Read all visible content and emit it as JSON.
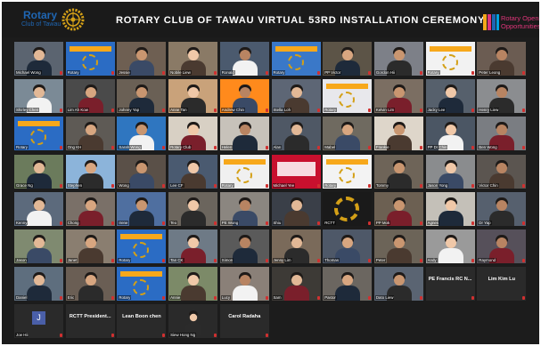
{
  "banner": {
    "title": "ROTARY CLUB OF TAWAU VIRTUAL 53RD INSTALLATION CEREMONY",
    "logo_word": "Rotary",
    "logo_club": "Club of Tawau",
    "right_line1": "Rotary Opens",
    "right_line2": "Opportunities",
    "accent_color": "#1f66b3",
    "gold_color": "#d4a017"
  },
  "tiles": [
    {
      "name": "Michael Wong",
      "kind": "person",
      "bg": "#5b6470"
    },
    {
      "name": "Rotary",
      "kind": "slide",
      "bg": "#2b6cc4"
    },
    {
      "name": "Jessie",
      "kind": "person",
      "bg": "#6e5f52"
    },
    {
      "name": "Nobile Liew",
      "kind": "person",
      "bg": "#8a7a66"
    },
    {
      "name": "Ronald",
      "kind": "person",
      "bg": "#4b5a6e"
    },
    {
      "name": "Rotary",
      "kind": "slide",
      "bg": "#3a78c8"
    },
    {
      "name": "PP Victor",
      "kind": "person",
      "bg": "#5c5447"
    },
    {
      "name": "Gordon Hii",
      "kind": "person",
      "bg": "#7d8088"
    },
    {
      "name": "Rotary",
      "kind": "slide",
      "bg": "#f2f2f2"
    },
    {
      "name": "Peter Leong",
      "kind": "person",
      "bg": "#6b5c52"
    },
    {
      "name": "Shirley Chen",
      "kind": "person",
      "bg": "#7b8a96"
    },
    {
      "name": "Lim Ah Kow",
      "kind": "person",
      "bg": "#4a4a4a"
    },
    {
      "name": "Johnny Yap",
      "kind": "person",
      "bg": "#6a6055"
    },
    {
      "name": "Anne Tan",
      "kind": "person",
      "bg": "#c9a27a"
    },
    {
      "name": "Andrew Chin",
      "kind": "person",
      "bg": "#ff8a1c"
    },
    {
      "name": "Stella Loh",
      "kind": "person",
      "bg": "#5d6675"
    },
    {
      "name": "Rotary",
      "kind": "slide",
      "bg": "#e8e8ec"
    },
    {
      "name": "Kelvin Lim",
      "kind": "person",
      "bg": "#7b6e62"
    },
    {
      "name": "Jacky Lee",
      "kind": "person",
      "bg": "#56606c"
    },
    {
      "name": "Henry Liew",
      "kind": "person",
      "bg": "#8b8d90"
    },
    {
      "name": "Rotary",
      "kind": "slide",
      "bg": "#2b6cc4"
    },
    {
      "name": "Ong KH",
      "kind": "person",
      "bg": "#5e5a55"
    },
    {
      "name": "Sarah Wong",
      "kind": "person",
      "bg": "#2f76c0"
    },
    {
      "name": "Rotary Club",
      "kind": "person",
      "bg": "#d8d0c4"
    },
    {
      "name": "Helen",
      "kind": "person",
      "bg": "#c7c2ba"
    },
    {
      "name": "Alan",
      "kind": "person",
      "bg": "#4f5865"
    },
    {
      "name": "Mabel",
      "kind": "person",
      "bg": "#6f6a60"
    },
    {
      "name": "Frankie",
      "kind": "person",
      "bg": "#ded6ca"
    },
    {
      "name": "PP Dr Chin",
      "kind": "person",
      "bg": "#4b5664"
    },
    {
      "name": "Ben Wong",
      "kind": "person",
      "bg": "#7a7d82"
    },
    {
      "name": "Grace Ng",
      "kind": "person",
      "bg": "#6b7b5c"
    },
    {
      "name": "Stephen",
      "kind": "person",
      "bg": "#8cb4da"
    },
    {
      "name": "Wong",
      "kind": "person",
      "bg": "#5a5048"
    },
    {
      "name": "Lee CF",
      "kind": "person",
      "bg": "#4a5a70"
    },
    {
      "name": "Rotary",
      "kind": "slide",
      "bg": "#f0f0f0"
    },
    {
      "name": "Michael Yee",
      "kind": "slide-red",
      "bg": "#c8102e"
    },
    {
      "name": "Rotary",
      "kind": "slide",
      "bg": "#f3f3f3"
    },
    {
      "name": "Tommy",
      "kind": "person",
      "bg": "#6e6458"
    },
    {
      "name": "Jason Yong",
      "kind": "person",
      "bg": "#8a8c8e"
    },
    {
      "name": "Victor Chin",
      "kind": "person",
      "bg": "#5b5550"
    },
    {
      "name": "Kenny",
      "kind": "person",
      "bg": "#5c6a7c"
    },
    {
      "name": "Chong",
      "kind": "person",
      "bg": "#7a7068"
    },
    {
      "name": "Irene",
      "kind": "person",
      "bg": "#4f6fa0"
    },
    {
      "name": "Teo",
      "kind": "person",
      "bg": "#6b655d"
    },
    {
      "name": "PE Wong",
      "kind": "person",
      "bg": "#8b8680"
    },
    {
      "name": "Shiu",
      "kind": "person",
      "bg": "#3a3f48"
    },
    {
      "name": "RCTT",
      "kind": "wheel",
      "bg": "#1a1a1a"
    },
    {
      "name": "PP Mok",
      "kind": "person",
      "bg": "#6c6052"
    },
    {
      "name": "Agnes",
      "kind": "person",
      "bg": "#c4c0b8"
    },
    {
      "name": "Dr Yap",
      "kind": "person",
      "bg": "#56606e"
    },
    {
      "name": "Jason",
      "kind": "person",
      "bg": "#7f8a70"
    },
    {
      "name": "Janet",
      "kind": "person",
      "bg": "#8a7e70"
    },
    {
      "name": "Rotary",
      "kind": "slide",
      "bg": "#2b6cc4"
    },
    {
      "name": "Tan CK",
      "kind": "person",
      "bg": "#6e7a86"
    },
    {
      "name": "Simon",
      "kind": "person",
      "bg": "#5a5a5a"
    },
    {
      "name": "Jenny Lim",
      "kind": "person",
      "bg": "#7a6a5a"
    },
    {
      "name": "Thomas",
      "kind": "person",
      "bg": "#4e5868"
    },
    {
      "name": "Peter",
      "kind": "person",
      "bg": "#6c6458"
    },
    {
      "name": "Andy",
      "kind": "person",
      "bg": "#9a9a9a"
    },
    {
      "name": "Raymond",
      "kind": "person",
      "bg": "#56505a"
    },
    {
      "name": "Daniel",
      "kind": "person",
      "bg": "#5e6e7e"
    },
    {
      "name": "Eric",
      "kind": "person",
      "bg": "#6a5e54"
    },
    {
      "name": "Rotary",
      "kind": "slide",
      "bg": "#2b6cc4"
    },
    {
      "name": "Annie",
      "kind": "person",
      "bg": "#7c8a68"
    },
    {
      "name": "Lucy",
      "kind": "person",
      "bg": "#8a8078"
    },
    {
      "name": "Sam",
      "kind": "person",
      "bg": "#3d3a36"
    },
    {
      "name": "Pastor",
      "kind": "person",
      "bg": "#6b6660"
    },
    {
      "name": "Dato Liew",
      "kind": "person",
      "bg": "#5a6472"
    },
    {
      "name": "PE Francis RC N...",
      "kind": "big",
      "bg": "#2a2a2a"
    },
    {
      "name": "Lim Kim Lu",
      "kind": "big",
      "bg": "#2a2a2a"
    },
    {
      "name": "Joe Hii",
      "kind": "avatar",
      "bg": "#2a2a2a"
    },
    {
      "name": "RCTT President...",
      "kind": "big",
      "bg": "#2a2a2a"
    },
    {
      "name": "Lean Boon chen",
      "kind": "big",
      "bg": "#2a2a2a"
    },
    {
      "name": "Siew Hong Ng",
      "kind": "small-person",
      "bg": "#2a2a2a"
    },
    {
      "name": "Carol Radaha",
      "kind": "big",
      "bg": "#2a2a2a"
    }
  ],
  "avatar_letter": "J"
}
